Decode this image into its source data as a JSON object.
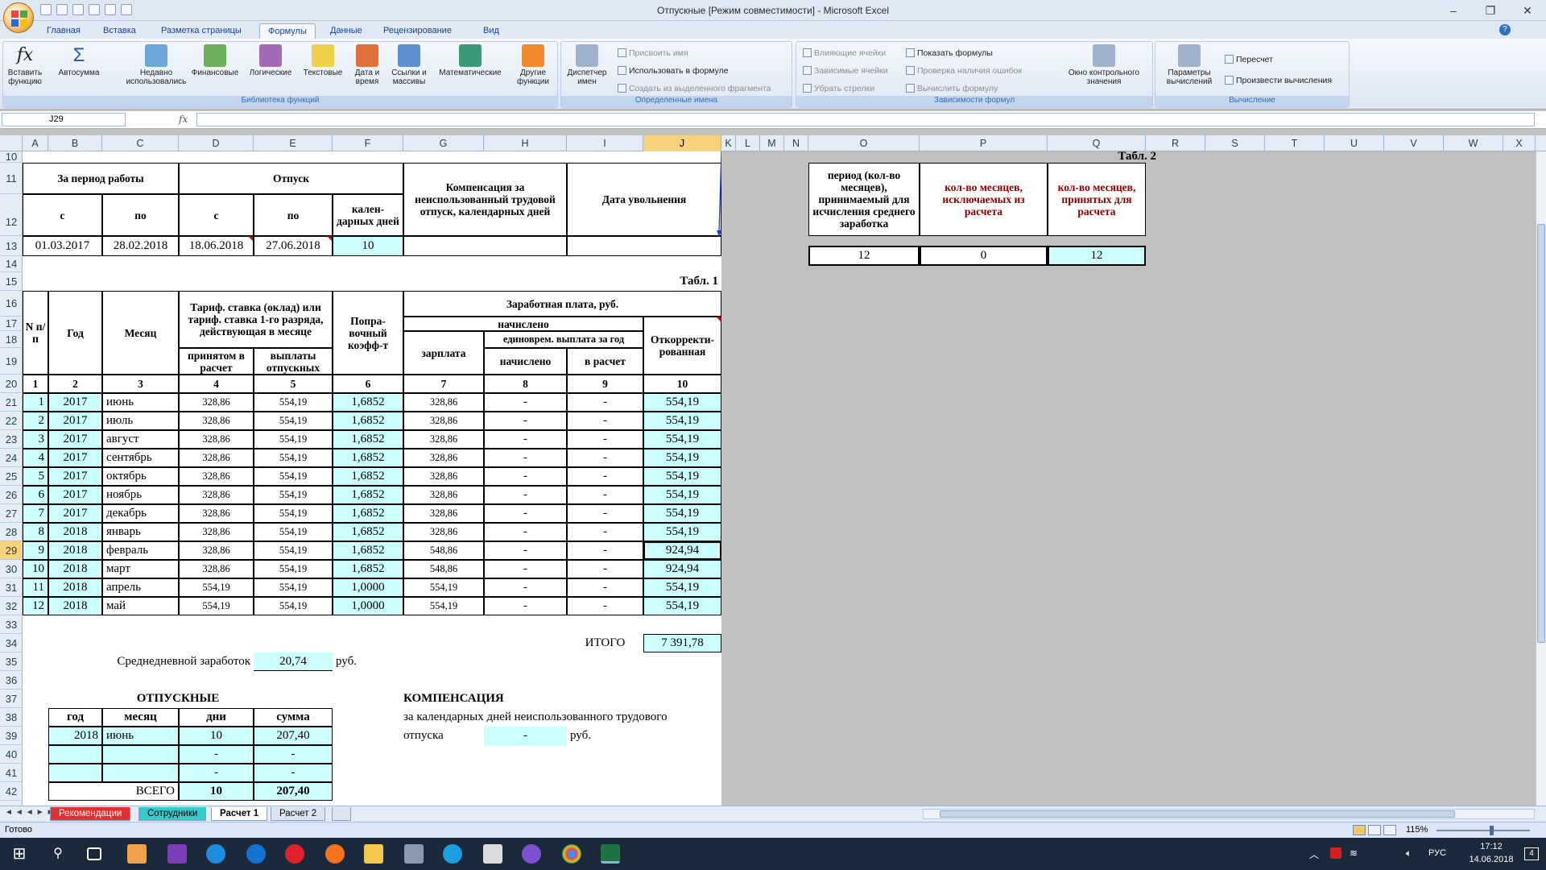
{
  "window": {
    "title": "Отпускные  [Режим совместимости] - Microsoft Excel"
  },
  "tabs": [
    "Главная",
    "Вставка",
    "Разметка страницы",
    "Формулы",
    "Данные",
    "Рецензирование",
    "Вид"
  ],
  "ribbon": {
    "groups": [
      "Библиотека функций",
      "Определенные имена",
      "Зависимости формул",
      "Вычисление"
    ],
    "lib_buttons": [
      "Вставить функцию",
      "Автосумма",
      "Недавно использовались",
      "Финансовые",
      "Логические",
      "Текстовые",
      "Дата и время",
      "Ссылки и массивы",
      "Математические",
      "Другие функции"
    ],
    "names_big": "Диспетчер имен",
    "names_small": [
      "Присвоить имя",
      "Использовать в формуле",
      "Создать из выделенного фрагмента"
    ],
    "deps_small": [
      "Влияющие ячейки",
      "Зависимые ячейки",
      "Убрать стрелки",
      "Показать формулы",
      "Проверка наличия ошибок",
      "Вычислить формулу"
    ],
    "watch": "Окно контрольного значения",
    "calc_big": "Параметры вычислений",
    "calc_small": [
      "Пересчет",
      "Произвести вычисления"
    ]
  },
  "formula_bar": {
    "namebox": "J29",
    "fx": "fx",
    "formula": ""
  },
  "columns": [
    "A",
    "B",
    "C",
    "D",
    "E",
    "F",
    "G",
    "H",
    "I",
    "J",
    "K",
    "L",
    "M",
    "N",
    "O",
    "P",
    "Q",
    "R",
    "S",
    "T",
    "U",
    "V",
    "W",
    "X"
  ],
  "rows": [
    "10",
    "11",
    "12",
    "13",
    "14",
    "15",
    "16",
    "17",
    "18",
    "19",
    "20",
    "21",
    "22",
    "23",
    "24",
    "25",
    "26",
    "27",
    "28",
    "29",
    "30",
    "31",
    "32",
    "33",
    "34",
    "35",
    "36",
    "37",
    "38",
    "39",
    "40",
    "41",
    "42"
  ],
  "top": {
    "period_hdr": "За период работы",
    "vac_hdr": "Отпуск",
    "comp_hdr": "Компенсация  за неиспользованный трудовой отпуск, календарных дней",
    "dismiss_hdr": "Дата увольнения",
    "from": "с",
    "to": "по",
    "vfrom": "с",
    "vto": "по",
    "caldays": "кален-дарных дней",
    "p_from": "01.03.2017",
    "p_to": "28.02.2018",
    "v_from": "18.06.2018",
    "v_to": "27.06.2018",
    "days": "10",
    "comp": "",
    "dismiss": ""
  },
  "t2": {
    "title": "Табл. 2",
    "h1": "период (кол-во месяцев), принимаемый для исчисления среднего заработка",
    "h2": "кол-во месяцев, исключаемых из расчета",
    "h3": "кол-во месяцев, принятых для расчета",
    "v1": "12",
    "v2": "0",
    "v3": "12"
  },
  "t1": {
    "title": "Табл. 1",
    "np": "N п/п",
    "year": "Год",
    "month": "Месяц",
    "rate": "Тариф. ставка (оклад) или тариф. ставка 1-го разряда, действующая в месяце",
    "rate_acc": "принятом  в расчет",
    "rate_pay": "выплаты отпускных",
    "coef": "Попра-вочный коэфф-т",
    "salary": "Заработная плата, руб.",
    "accrued": "начислено",
    "zarplata": "зарплата",
    "onetime": "единоврем. выплата за год",
    "ot_acc": "начислено",
    "ot_calc": "в расчет",
    "adj": "Откорректи-рованная",
    "nums": [
      "1",
      "2",
      "3",
      "4",
      "5",
      "6",
      "7",
      "8",
      "9",
      "10"
    ],
    "rows": [
      [
        "1",
        "2017",
        "июнь",
        "328,86",
        "554,19",
        "1,6852",
        "328,86",
        "-",
        "-",
        "554,19"
      ],
      [
        "2",
        "2017",
        "июль",
        "328,86",
        "554,19",
        "1,6852",
        "328,86",
        "-",
        "-",
        "554,19"
      ],
      [
        "3",
        "2017",
        "август",
        "328,86",
        "554,19",
        "1,6852",
        "328,86",
        "-",
        "-",
        "554,19"
      ],
      [
        "4",
        "2017",
        "сентябрь",
        "328,86",
        "554,19",
        "1,6852",
        "328,86",
        "-",
        "-",
        "554,19"
      ],
      [
        "5",
        "2017",
        "октябрь",
        "328,86",
        "554,19",
        "1,6852",
        "328,86",
        "-",
        "-",
        "554,19"
      ],
      [
        "6",
        "2017",
        "ноябрь",
        "328,86",
        "554,19",
        "1,6852",
        "328,86",
        "-",
        "-",
        "554,19"
      ],
      [
        "7",
        "2017",
        "декабрь",
        "328,86",
        "554,19",
        "1,6852",
        "328,86",
        "-",
        "-",
        "554,19"
      ],
      [
        "8",
        "2018",
        "январь",
        "328,86",
        "554,19",
        "1,6852",
        "328,86",
        "-",
        "-",
        "554,19"
      ],
      [
        "9",
        "2018",
        "февраль",
        "328,86",
        "554,19",
        "1,6852",
        "548,86",
        "-",
        "-",
        "924,94"
      ],
      [
        "10",
        "2018",
        "март",
        "328,86",
        "554,19",
        "1,6852",
        "548,86",
        "-",
        "-",
        "924,94"
      ],
      [
        "11",
        "2018",
        "апрель",
        "554,19",
        "554,19",
        "1,0000",
        "554,19",
        "-",
        "-",
        "554,19"
      ],
      [
        "12",
        "2018",
        "май",
        "554,19",
        "554,19",
        "1,0000",
        "554,19",
        "-",
        "-",
        "554,19"
      ]
    ],
    "total_label": "ИТОГО",
    "total": "7 391,78"
  },
  "avg": {
    "label": "Среднедневной заработок",
    "value": "20,74",
    "unit": "руб."
  },
  "vac": {
    "title": "ОТПУСКНЫЕ",
    "h": [
      "год",
      "месяц",
      "дни",
      "сумма"
    ],
    "rows": [
      [
        "2018",
        "июнь",
        "10",
        "207,40"
      ],
      [
        "",
        "",
        "-",
        "-"
      ],
      [
        "",
        "",
        "-",
        "-"
      ]
    ],
    "total_label": "ВСЕГО",
    "total_days": "10",
    "total_sum": "207,40"
  },
  "comp": {
    "title": "КОМПЕНСАЦИЯ",
    "line1": "за  календарных дней неиспользованного трудового",
    "line2": "отпуска",
    "value": "-",
    "unit": "руб."
  },
  "sheets": [
    "Рекомендации",
    "Сотрудники",
    "Расчет 1",
    "Расчет 2"
  ],
  "status": {
    "ready": "Готово",
    "zoom": "115%"
  },
  "tray": {
    "lang": "РУС",
    "time": "17:12",
    "date": "14.06.2018",
    "notif": "4"
  }
}
